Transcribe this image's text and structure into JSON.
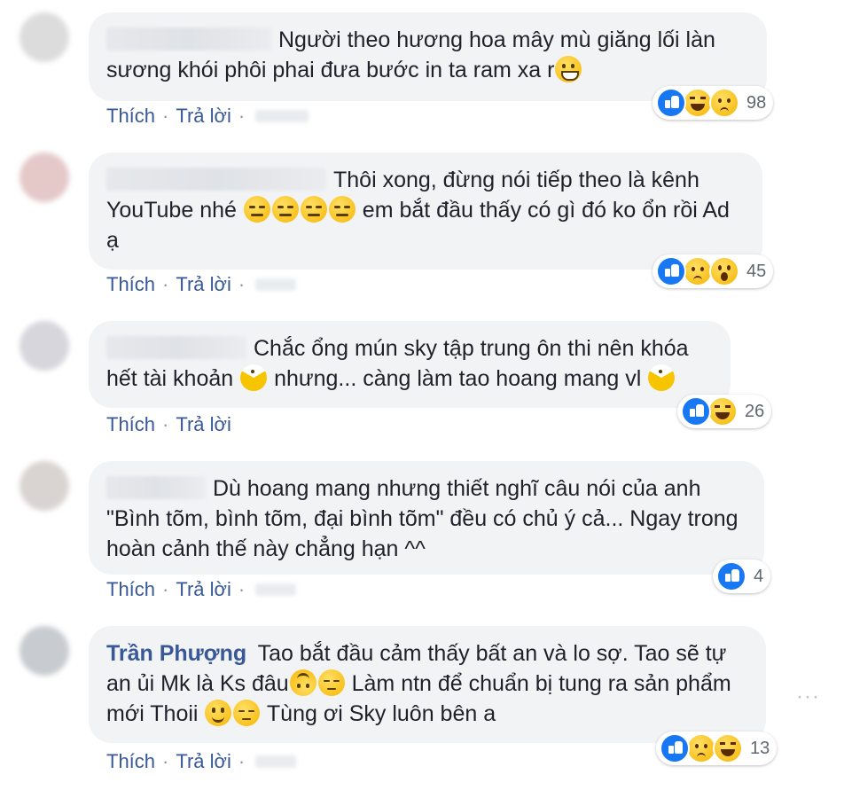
{
  "comments": [
    {
      "author": "",
      "text_parts": [
        "Người theo hương hoa mây mù giăng lối làn sương khói phôi phai đưa bước in ta ram xa r"
      ],
      "emojis": [
        "grinning-sweat-icon"
      ],
      "reactions": [
        "like-icon",
        "haha-icon",
        "sad-icon"
      ],
      "reaction_count": "98",
      "like_label": "Thích",
      "reply_label": "Trả lời",
      "separator": "·"
    },
    {
      "author": "",
      "text_parts": [
        "Thôi xong, đừng nói tiếp theo là kênh YouTube nhé ",
        " em bắt đầu thấy có gì đó ko ổn rồi Ad ạ"
      ],
      "emojis": [
        "expressionless-icon"
      ],
      "reactions": [
        "like-icon",
        "sad-icon",
        "wow-icon"
      ],
      "reaction_count": "45",
      "like_label": "Thích",
      "reply_label": "Trả lời",
      "separator": "·"
    },
    {
      "author": "",
      "text_parts": [
        "Chắc ổng mún sky tập trung ôn thi nên khóa hết tài khoản ",
        " nhưng... càng làm tao hoang mang vl "
      ],
      "emojis": [
        "pacman-icon"
      ],
      "reactions": [
        "like-icon",
        "haha-icon"
      ],
      "reaction_count": "26",
      "like_label": "Thích",
      "reply_label": "Trả lời",
      "separator": "·"
    },
    {
      "author": "",
      "text_parts": [
        "Dù hoang mang nhưng thiết nghĩ câu nói của anh \"Bình tõm, bình tõm, đại bình tõm\" đều có chủ ý cả... Ngay trong hoàn cảnh thế này chẳng hạn ^^"
      ],
      "emojis": [],
      "reactions": [
        "like-icon"
      ],
      "reaction_count": "4",
      "like_label": "Thích",
      "reply_label": "Trả lời",
      "separator": "·"
    },
    {
      "author": "Trần Phượng",
      "text_parts": [
        " Tao bắt đầu cảm thấy bất an và lo sợ. Tao sẽ tự an ủi Mk là Ks đâu",
        " Làm ntn để chuẩn bị tung ra sản phẩm mới Thoii ",
        " Tùng ơi Sky luôn bên a"
      ],
      "emojis": [
        "upside-down-icon",
        "pensive-icon",
        "smile-icon"
      ],
      "reactions": [
        "like-icon",
        "sad-icon",
        "haha-icon"
      ],
      "reaction_count": "13",
      "like_label": "Thích",
      "reply_label": "Trả lời",
      "separator": "·"
    }
  ],
  "more_label": "···"
}
